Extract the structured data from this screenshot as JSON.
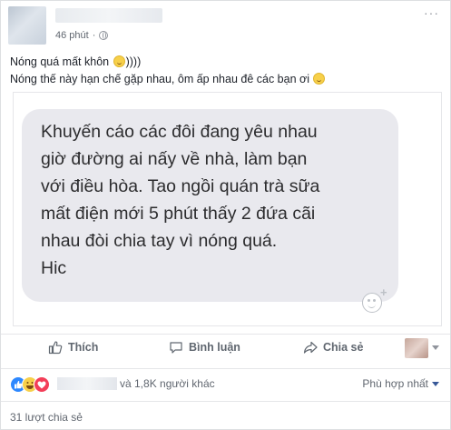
{
  "post": {
    "time": "46 phút",
    "text_line1_a": "Nóng quá mất khôn",
    "text_line1_b": "))))",
    "text_line2": "Nóng thế này hạn chế gặp nhau, ôm ấp nhau đê các bạn ơi",
    "icons": [
      "globe-icon",
      "more-options-icon",
      "smile-emoji-icon"
    ]
  },
  "image": {
    "message_lines": [
      "Khuyến cáo các đôi đang yêu nhau",
      "giờ đường ai nấy về nhà, làm bạn",
      "với điều hòa. Tao ngồi quán trà sữa",
      "mất điện mới 5 phút thấy 2 đứa cãi",
      "nhau đòi chia tay vì nóng quá.",
      "Hic"
    ],
    "bubble_color": "#e9e9ee"
  },
  "actions": {
    "like_label": "Thích",
    "comment_label": "Bình luận",
    "share_label": "Chia sẻ"
  },
  "reactions": {
    "others_text": "và 1,8K người khác",
    "sort_label": "Phù hợp nhất",
    "types": [
      "like-icon",
      "haha-icon",
      "love-icon"
    ]
  },
  "shares": {
    "label": "31 lượt chia sẻ"
  },
  "colors": {
    "link_blue": "#385898",
    "like_blue": "#2d88ff",
    "love_red": "#f33e58",
    "haha_yellow": "#f7d04a",
    "muted_text": "#616770"
  }
}
